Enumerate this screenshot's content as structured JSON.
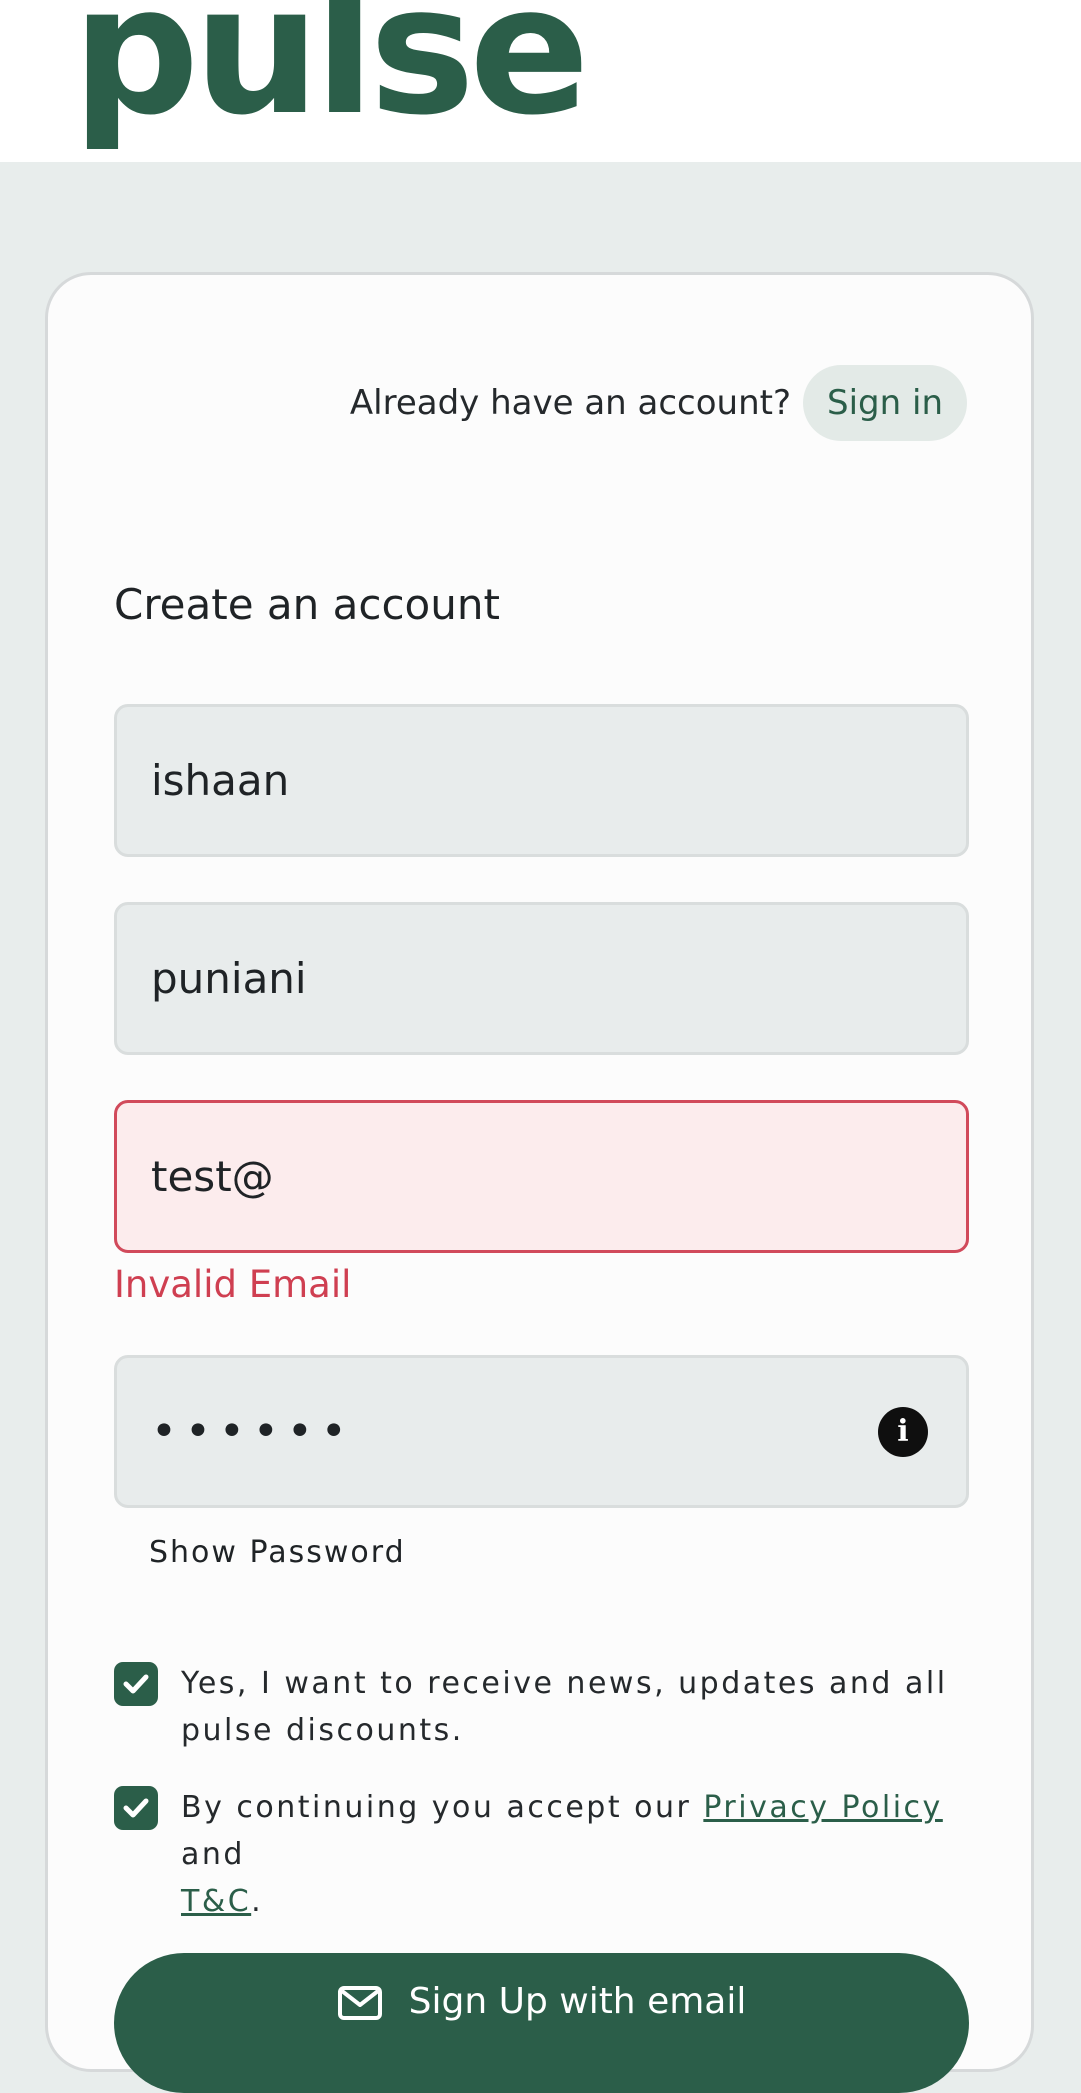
{
  "header": {
    "logo_text": "pulse"
  },
  "signin": {
    "prompt": "Already have an account?",
    "button_label": "Sign in"
  },
  "form": {
    "title": "Create an account",
    "first_name_value": "ishaan",
    "last_name_value": "puniani",
    "email_value": "test@",
    "email_error": "Invalid Email",
    "password_value": "••••••",
    "info_icon": "info-icon",
    "show_password_label": "Show Password",
    "newsletter_label": "Yes, I want to receive news, updates and all pulse discounts.",
    "newsletter_checked": true,
    "terms_prefix": "By continuing you accept our ",
    "privacy_link": "Privacy Policy",
    "terms_middle": " and ",
    "tc_link": "T&C",
    "terms_suffix": ".",
    "terms_checked": true,
    "submit_label": "Sign Up with email"
  },
  "colors": {
    "brand": "#2b5e49",
    "error": "#cf3f51",
    "page_bg": "#e8edec"
  }
}
